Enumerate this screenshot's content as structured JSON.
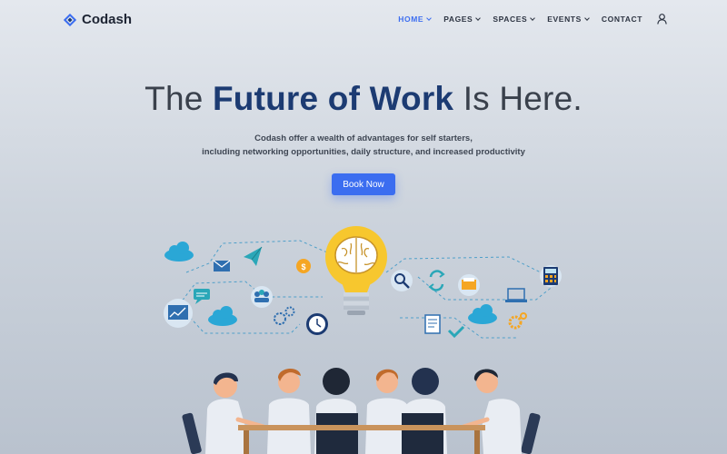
{
  "brand": {
    "name": "Codash",
    "logo_icon": "diamond-logo-icon"
  },
  "nav": {
    "items": [
      {
        "label": "HOME",
        "active": true,
        "has_dropdown": true
      },
      {
        "label": "PAGES",
        "active": false,
        "has_dropdown": true
      },
      {
        "label": "SPACES",
        "active": false,
        "has_dropdown": true
      },
      {
        "label": "EVENTS",
        "active": false,
        "has_dropdown": true
      },
      {
        "label": "CONTACT",
        "active": false,
        "has_dropdown": false
      }
    ],
    "account_icon": "user-icon"
  },
  "hero": {
    "title_pre": "The",
    "title_accent": "Future of Work",
    "title_post": "Is Here.",
    "subtitle_line1": "Codash offer a wealth of advantages for self starters,",
    "subtitle_line2": "including networking opportunities, daily structure, and increased productivity",
    "cta_label": "Book Now"
  },
  "colors": {
    "accent": "#3b6df0",
    "title_accent": "#1c3b72",
    "bulb": "#f7c72e",
    "icon_teal": "#2aa7b8"
  }
}
